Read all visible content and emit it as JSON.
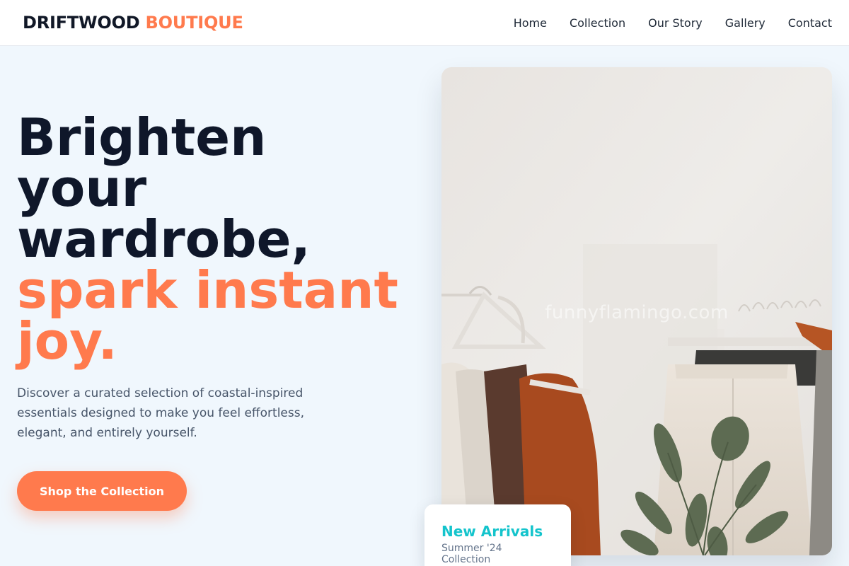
{
  "brand": {
    "part1": "DRIFTWOOD",
    "part2": "BOUTIQUE"
  },
  "nav": {
    "items": [
      {
        "label": "Home"
      },
      {
        "label": "Collection"
      },
      {
        "label": "Our Story"
      },
      {
        "label": "Gallery"
      },
      {
        "label": "Contact"
      }
    ]
  },
  "hero": {
    "headline_lines": [
      "Brighten",
      "your",
      "wardrobe,"
    ],
    "headline_accent_lines": [
      "spark instant",
      "joy."
    ],
    "subtitle": "Discover a curated selection of coastal-inspired essentials designed to make you feel effortless, elegant, and entirely yourself.",
    "cta_label": "Shop the Collection",
    "image_watermark": "funnyflamingo.com"
  },
  "badge": {
    "title": "New Arrivals",
    "subtitle": "Summer '24 Collection"
  },
  "colors": {
    "accent": "#ff7a4d",
    "teal": "#14c4cc",
    "dark": "#0f172a",
    "background": "#f0f7fd"
  },
  "icons": {
    "hero_image": "clothing-rack-photo"
  }
}
